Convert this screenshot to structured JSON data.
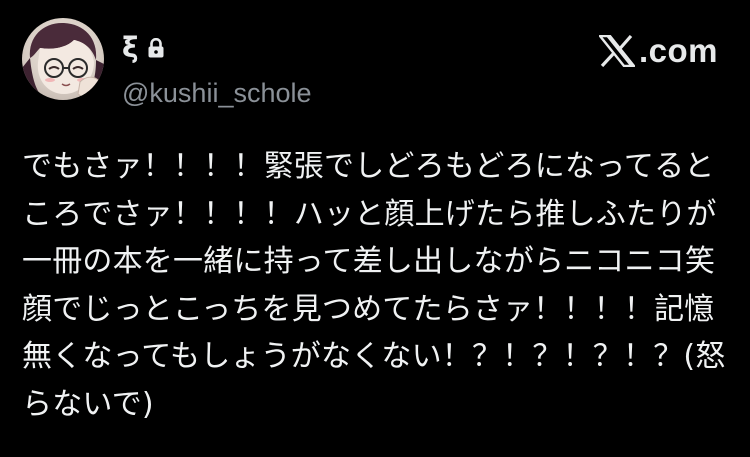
{
  "profile": {
    "display_name": "ξ",
    "handle": "@kushii_schole",
    "avatar_icon": "anime-character-avatar",
    "locked_icon": "lock-icon"
  },
  "brand": {
    "label": ".com",
    "logo_icon": "x-logo-icon"
  },
  "tweet": {
    "lines": [
      "でもさァ！！！！緊張でしどろもどろになってると",
      "ころでさァ！！！！ハッと顔上げたら推しふたりが",
      "一冊の本を一緒に持って差し出しながらニコニコ笑",
      "顔でじっとこっちを見つめてたらさァ！！！！記憶",
      "無くなってもしょうがなくない！？！？！？！？(怒",
      "らないで)"
    ]
  },
  "colors": {
    "background": "#000000",
    "text": "#e7e9ea",
    "handle": "#8b9198"
  }
}
